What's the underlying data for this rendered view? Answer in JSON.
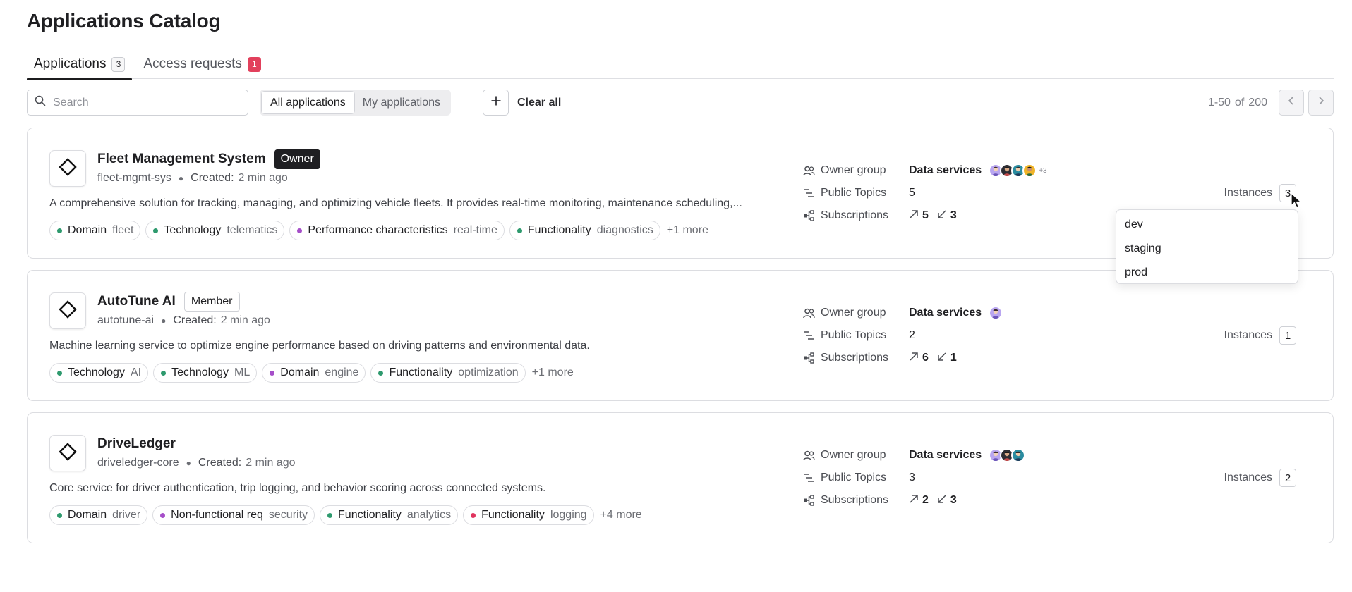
{
  "page": {
    "title": "Applications Catalog"
  },
  "tabs": [
    {
      "label": "Applications",
      "count": "3"
    },
    {
      "label": "Access requests",
      "count": "1"
    }
  ],
  "toolbar": {
    "search_placeholder": "Search",
    "segments": [
      "All applications",
      "My applications"
    ],
    "clear_all": "Clear all",
    "pager_range": "1-50",
    "pager_of": "of",
    "pager_total": "200"
  },
  "labels": {
    "owner_group": "Owner group",
    "public_topics": "Public Topics",
    "subscriptions": "Subscriptions",
    "instances": "Instances",
    "created": "Created:"
  },
  "colors": {
    "green": "#2e9a6e",
    "purple": "#a64fc9",
    "pink": "#e0335e",
    "alert": "#e2405c"
  },
  "apps": [
    {
      "name": "Fleet Management System",
      "role": "Owner",
      "slug": "fleet-mgmt-sys",
      "created": "2 min ago",
      "description": "A comprehensive solution for tracking, managing, and optimizing vehicle fleets. It provides real-time monitoring, maintenance scheduling,...",
      "tags": [
        {
          "key": "Domain",
          "value": "fleet",
          "color": "#2e9a6e"
        },
        {
          "key": "Technology",
          "value": "telematics",
          "color": "#2e9a6e"
        },
        {
          "key": "Performance characteristics",
          "value": "real-time",
          "color": "#a64fc9"
        },
        {
          "key": "Functionality",
          "value": "diagnostics",
          "color": "#2e9a6e"
        }
      ],
      "more": "+1 more",
      "owner_group": "Data services",
      "avatars_more": "+3",
      "public_topics": "5",
      "subs_out": "5",
      "subs_in": "3",
      "instances": "3"
    },
    {
      "name": "AutoTune AI",
      "role": "Member",
      "slug": "autotune-ai",
      "created": "2 min ago",
      "description": "Machine learning service to optimize engine performance based on driving patterns and environmental data.",
      "tags": [
        {
          "key": "Technology",
          "value": "AI",
          "color": "#2e9a6e"
        },
        {
          "key": "Technology",
          "value": "ML",
          "color": "#2e9a6e"
        },
        {
          "key": "Domain",
          "value": "engine",
          "color": "#a64fc9"
        },
        {
          "key": "Functionality",
          "value": "optimization",
          "color": "#2e9a6e"
        }
      ],
      "more": "+1 more",
      "owner_group": "Data services",
      "public_topics": "2",
      "subs_out": "6",
      "subs_in": "1",
      "instances": "1"
    },
    {
      "name": "DriveLedger",
      "slug": "driveledger-core",
      "created": "2 min ago",
      "description": "Core service for driver authentication, trip logging, and behavior scoring across connected systems.",
      "tags": [
        {
          "key": "Domain",
          "value": "driver",
          "color": "#2e9a6e"
        },
        {
          "key": "Non-functional req",
          "value": "security",
          "color": "#a64fc9"
        },
        {
          "key": "Functionality",
          "value": "analytics",
          "color": "#2e9a6e"
        },
        {
          "key": "Functionality",
          "value": "logging",
          "color": "#e0335e"
        }
      ],
      "more": "+4 more",
      "owner_group": "Data services",
      "public_topics": "3",
      "subs_out": "2",
      "subs_in": "3",
      "instances": "2"
    }
  ],
  "instances_dropdown": [
    "dev",
    "staging",
    "prod"
  ]
}
